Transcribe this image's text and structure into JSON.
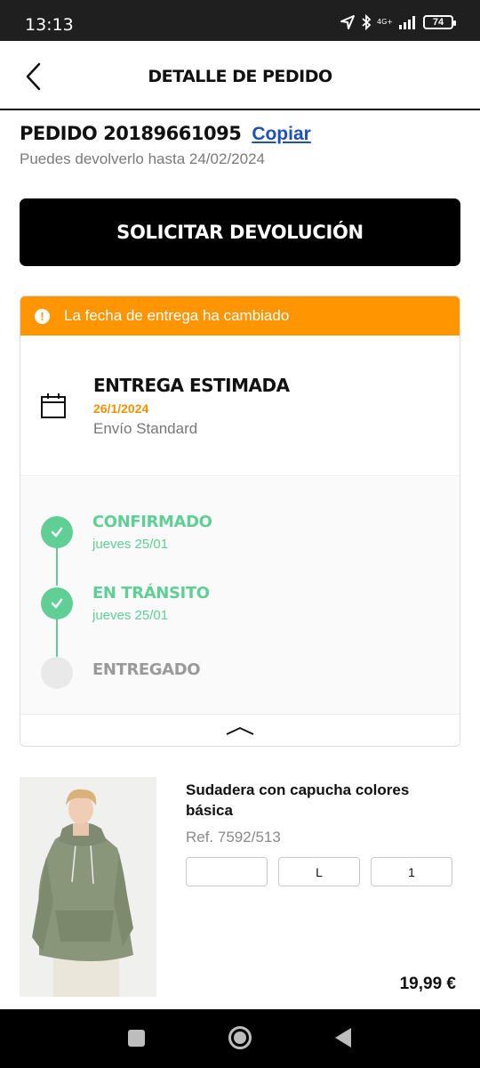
{
  "status_bar": {
    "time": "13:13",
    "network": "4G+",
    "battery": "74",
    "icons": [
      "location-arrow-icon",
      "bluetooth-icon",
      "signal-icon",
      "battery-icon"
    ]
  },
  "header": {
    "title": "DETALLE DE PEDIDO",
    "back_icon": "chevron-left-icon"
  },
  "order": {
    "title": "PEDIDO 20189661095",
    "copy_label": "Copiar",
    "return_until": "Puedes devolverlo hasta 24/02/2024",
    "return_button": "SOLICITAR DEVOLUCIÓN"
  },
  "delivery": {
    "alert": "La fecha de entrega ha cambiado",
    "alert_color": "#ff9500",
    "estimate_title": "ENTREGA ESTIMADA",
    "estimate_date": "26/1/2024",
    "shipping_method": "Envío Standard",
    "success_color": "#5fcf95",
    "timeline": [
      {
        "label": "CONFIRMADO",
        "date": "jueves 25/01",
        "done": true
      },
      {
        "label": "EN TRÁNSITO",
        "date": "jueves 25/01",
        "done": true
      },
      {
        "label": "ENTREGADO",
        "date": "",
        "done": false
      }
    ]
  },
  "product": {
    "name": "Sudadera con capucha colores básica",
    "ref": "Ref. 7592/513",
    "color": "",
    "size": "L",
    "quantity": "1",
    "price": "19,99 €"
  },
  "nav": {
    "icons": [
      "recents-square-icon",
      "home-circle-icon",
      "back-triangle-icon"
    ]
  }
}
